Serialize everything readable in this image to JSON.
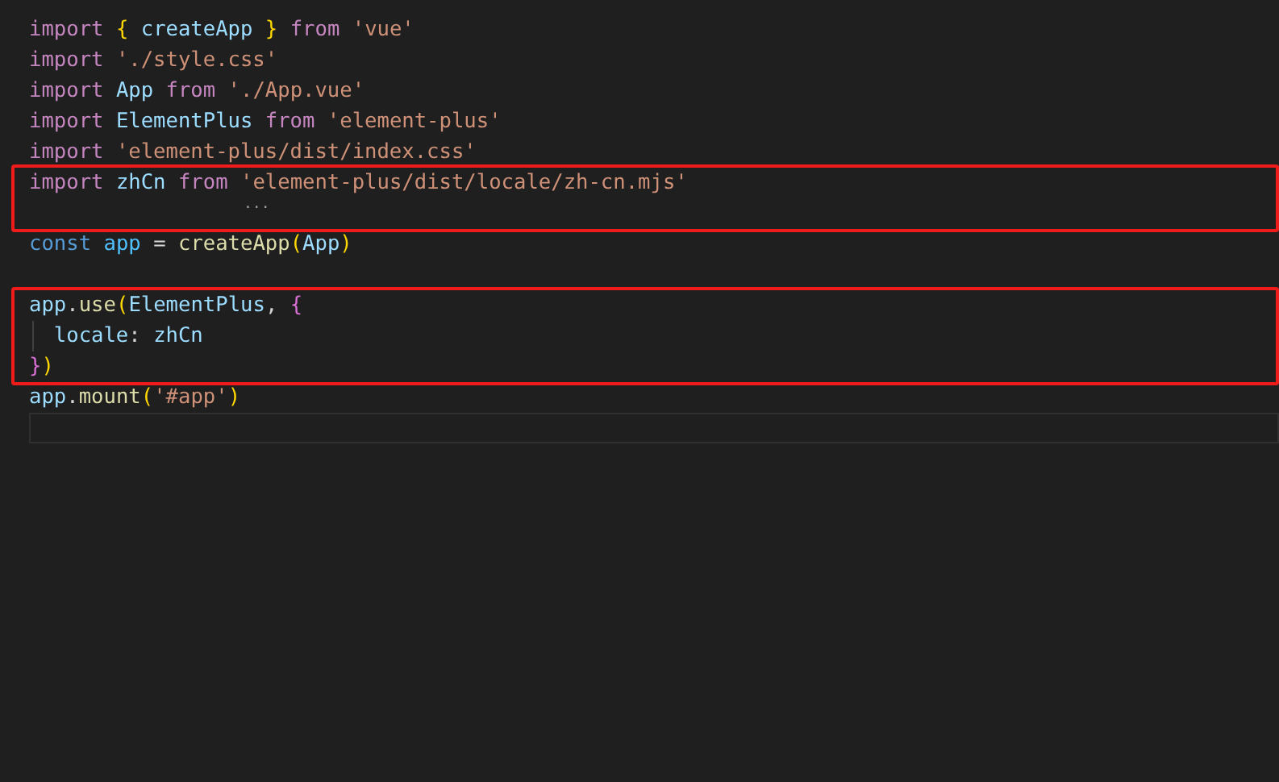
{
  "editor": {
    "blocks": [
      {
        "boxed": false,
        "lines": [
          {
            "kind": "code",
            "tokens": [
              {
                "kind": "keyword",
                "text": "import "
              },
              {
                "kind": "bracket",
                "text": "{ "
              },
              {
                "kind": "variable",
                "text": "createApp "
              },
              {
                "kind": "bracket",
                "text": "} "
              },
              {
                "kind": "keyword",
                "text": "from "
              },
              {
                "kind": "string",
                "text": "'vue'"
              }
            ]
          },
          {
            "kind": "code",
            "tokens": [
              {
                "kind": "keyword",
                "text": "import "
              },
              {
                "kind": "string",
                "text": "'./style.css'"
              }
            ]
          },
          {
            "kind": "code",
            "tokens": [
              {
                "kind": "keyword",
                "text": "import "
              },
              {
                "kind": "variable",
                "text": "App "
              },
              {
                "kind": "keyword",
                "text": "from "
              },
              {
                "kind": "string",
                "text": "'./App.vue'"
              }
            ]
          },
          {
            "kind": "code",
            "tokens": [
              {
                "kind": "keyword",
                "text": "import "
              },
              {
                "kind": "variable",
                "text": "ElementPlus "
              },
              {
                "kind": "keyword",
                "text": "from "
              },
              {
                "kind": "string",
                "text": "'element-plus'"
              }
            ]
          },
          {
            "kind": "code",
            "tokens": [
              {
                "kind": "keyword",
                "text": "import "
              },
              {
                "kind": "string",
                "text": "'element-plus/dist/index.css'"
              }
            ]
          }
        ]
      },
      {
        "boxed": true,
        "lines": [
          {
            "kind": "code",
            "tokens": [
              {
                "kind": "keyword",
                "text": "import "
              },
              {
                "kind": "variable",
                "text": "zhCn "
              },
              {
                "kind": "keyword",
                "text": "from "
              },
              {
                "kind": "string",
                "text": "'element-plus/dist/locale/zh-cn.mjs'"
              }
            ]
          },
          {
            "kind": "hint",
            "text": "..."
          }
        ]
      },
      {
        "boxed": false,
        "lines": [
          {
            "kind": "code",
            "tokens": [
              {
                "kind": "storage",
                "text": "const "
              },
              {
                "kind": "constant",
                "text": "app "
              },
              {
                "kind": "plain",
                "text": "= "
              },
              {
                "kind": "function",
                "text": "createApp"
              },
              {
                "kind": "bracket",
                "text": "("
              },
              {
                "kind": "variable",
                "text": "App"
              },
              {
                "kind": "bracket",
                "text": ")"
              }
            ]
          },
          {
            "kind": "blank"
          }
        ]
      },
      {
        "boxed": true,
        "lines": [
          {
            "kind": "code",
            "tokens": [
              {
                "kind": "variable",
                "text": "app"
              },
              {
                "kind": "plain",
                "text": "."
              },
              {
                "kind": "function",
                "text": "use"
              },
              {
                "kind": "bracket",
                "text": "("
              },
              {
                "kind": "variable",
                "text": "ElementPlus"
              },
              {
                "kind": "plain",
                "text": ", "
              },
              {
                "kind": "bracket2",
                "text": "{"
              }
            ]
          },
          {
            "kind": "indented",
            "tokens": [
              {
                "kind": "variable",
                "text": "locale"
              },
              {
                "kind": "plain",
                "text": ": "
              },
              {
                "kind": "variable",
                "text": "zhCn"
              }
            ]
          },
          {
            "kind": "code",
            "tokens": [
              {
                "kind": "bracket2",
                "text": "}"
              },
              {
                "kind": "bracket",
                "text": ")"
              }
            ]
          }
        ]
      },
      {
        "boxed": false,
        "lines": [
          {
            "kind": "code",
            "tokens": [
              {
                "kind": "variable",
                "text": "app"
              },
              {
                "kind": "plain",
                "text": "."
              },
              {
                "kind": "function",
                "text": "mount"
              },
              {
                "kind": "bracket",
                "text": "("
              },
              {
                "kind": "string",
                "text": "'#app'"
              },
              {
                "kind": "bracket",
                "text": ")"
              }
            ]
          },
          {
            "kind": "current"
          }
        ]
      }
    ]
  }
}
